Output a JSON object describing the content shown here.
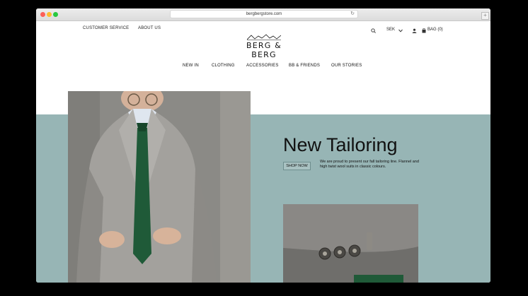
{
  "browser": {
    "url": "bergbergstore.com",
    "reload_icon": "reload-icon",
    "new_tab_symbol": "+"
  },
  "top_links": {
    "customer_service": "CUSTOMER SERVICE",
    "about_us": "ABOUT US"
  },
  "brand": {
    "name": "BERG & BERG",
    "logo_icon": "mountain-logo-icon"
  },
  "utility": {
    "currency": "SEK",
    "bag": "BAG (0)"
  },
  "menu": [
    "NEW IN",
    "CLOTHING",
    "ACCESSORIES",
    "BB & FRIENDS",
    "OUR STORIES"
  ],
  "hero": {
    "headline": "New Tailoring",
    "cta": "SHOP NOW",
    "description": "We are proud to present our fall tailoring line. Flannel and high twist wool suits in classic colours."
  },
  "colors": {
    "accent_teal": "#97b5b5",
    "text": "#111111"
  }
}
